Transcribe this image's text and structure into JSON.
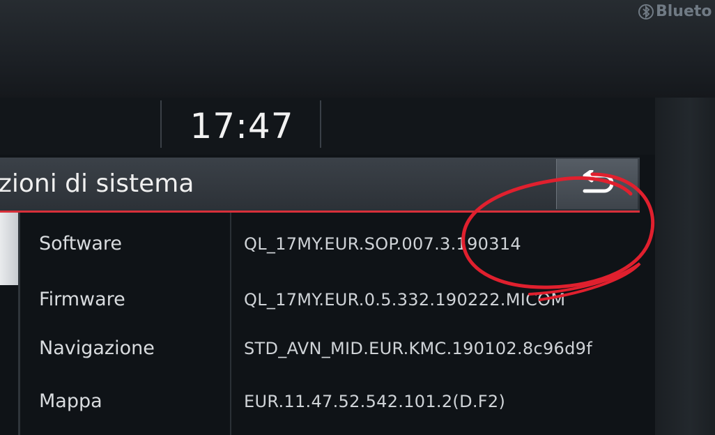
{
  "bezel": {
    "brand": "Blueto"
  },
  "status_bar": {
    "time": "17:47"
  },
  "header": {
    "title": "zioni di sistema",
    "back_icon": "back-arrow-icon"
  },
  "system_info": {
    "rows": [
      {
        "label": "Software",
        "value": "QL_17MY.EUR.SOP.007.3.190314"
      },
      {
        "label": "Firmware",
        "value": "QL_17MY.EUR.0.5.332.190222.MICOM"
      },
      {
        "label": "Navigazione",
        "value": "STD_AVN_MID.EUR.KMC.190102.8c96d9f"
      },
      {
        "label": "Mappa",
        "value": "EUR.11.47.52.542.101.2(D.F2)"
      }
    ]
  },
  "colors": {
    "accent_line": "#d8303a",
    "annotation": "#e0202e"
  }
}
